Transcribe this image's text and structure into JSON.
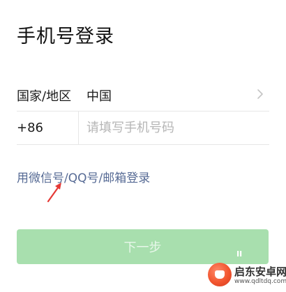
{
  "page": {
    "title": "手机号登录"
  },
  "region": {
    "label": "国家/地区",
    "value": "中国"
  },
  "phone": {
    "country_code": "+86",
    "placeholder": "请填写手机号码",
    "value": ""
  },
  "alt_login": {
    "label": "用微信号/QQ号/邮箱登录"
  },
  "next_button": {
    "label": "下一步"
  },
  "colors": {
    "link": "#576b95",
    "button_disabled_bg": "#a8dfae",
    "annotation_arrow": "#e53935"
  },
  "watermark": {
    "name": "启东安卓网",
    "url": "www.qdltdq.com"
  },
  "icons": {
    "chevron": "chevron-right-icon",
    "arrow": "red-arrow-annotation-icon"
  }
}
